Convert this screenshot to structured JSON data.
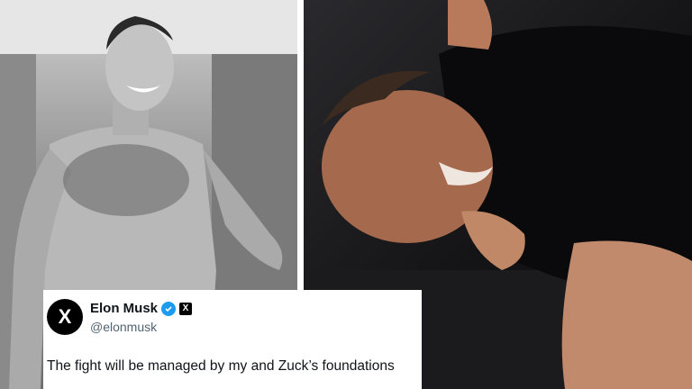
{
  "tweet": {
    "avatar_glyph": "X",
    "display_name": "Elon Musk",
    "x_badge": "X",
    "handle": "@elonmusk",
    "text": "The fight will be managed by my and Zuck’s foundations",
    "verified_color": "#1d9bf0"
  },
  "photos": {
    "left": {
      "tone": "black-and-white"
    },
    "right": {
      "tone": "color"
    }
  }
}
